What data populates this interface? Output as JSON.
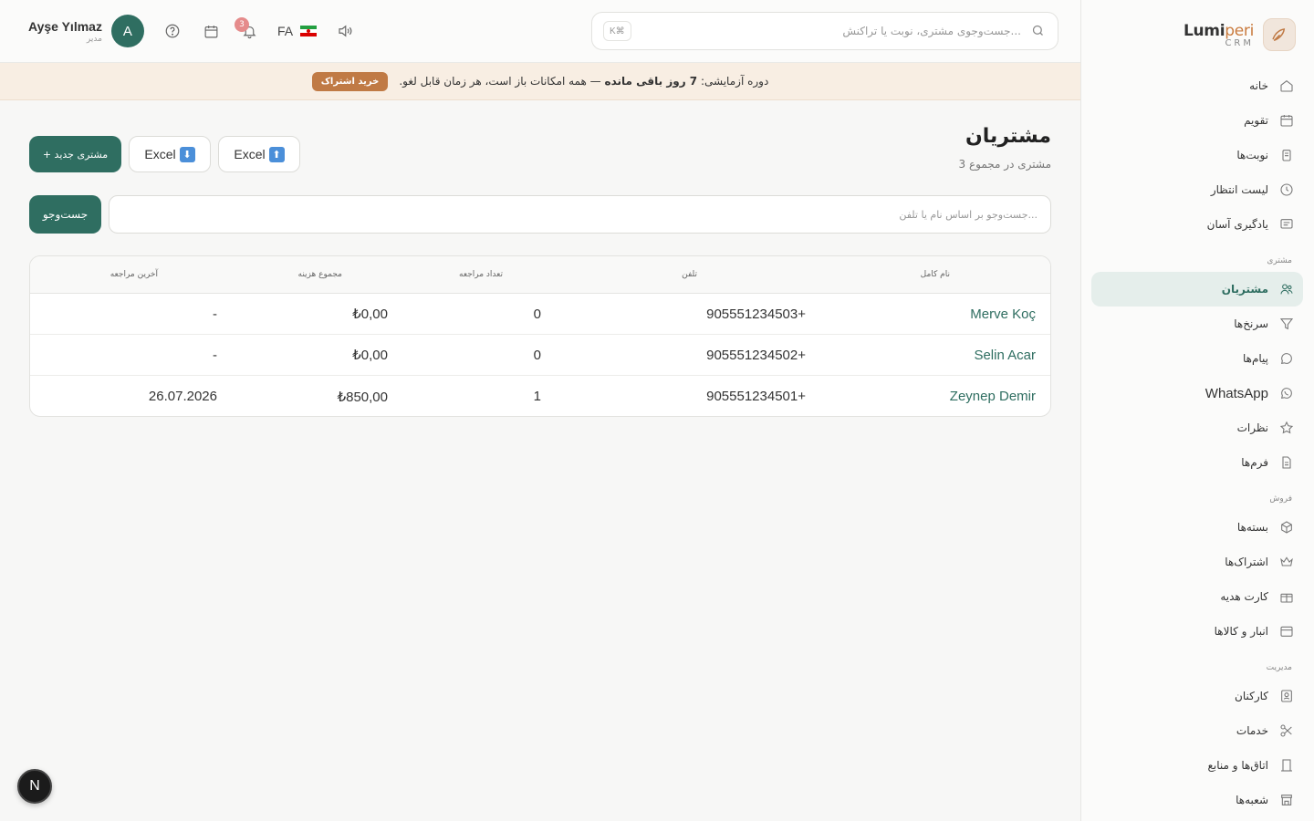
{
  "brand": {
    "name_main": "Lumi",
    "name_accent": "peri",
    "sub": "CRM"
  },
  "topbar": {
    "user_name": "Ayşe Yılmaz",
    "user_role": "مدیر",
    "avatar_initial": "A",
    "notification_count": "3",
    "language": "FA",
    "search_placeholder": "جست‌وجوی مشتری، نوبت یا تراکنش...",
    "search_shortcut": "K⌘"
  },
  "banner": {
    "text_before": "دوره آزمایشی:",
    "text_bold": "7 روز باقی مانده",
    "text_after": "— همه امکانات باز است، هر زمان قابل لغو.",
    "button": "خرید اشتراک"
  },
  "sidebar": {
    "items_top": [
      {
        "label": "خانه",
        "icon": "home-icon"
      },
      {
        "label": "تقویم",
        "icon": "calendar-icon"
      },
      {
        "label": "نوبت‌ها",
        "icon": "clipboard-icon"
      },
      {
        "label": "لیست انتظار",
        "icon": "clock-icon"
      },
      {
        "label": "یادگیری آسان",
        "icon": "message-square-icon"
      }
    ],
    "section_customer": "مشتری",
    "items_customer": [
      {
        "label": "مشتریان",
        "icon": "users-icon",
        "active": true
      },
      {
        "label": "سرنخ‌ها",
        "icon": "funnel-icon"
      },
      {
        "label": "پیام‌ها",
        "icon": "chat-icon"
      },
      {
        "label": "WhatsApp",
        "icon": "whatsapp-icon"
      },
      {
        "label": "نظرات",
        "icon": "star-icon"
      },
      {
        "label": "فرم‌ها",
        "icon": "document-icon"
      }
    ],
    "section_sales": "فروش",
    "items_sales": [
      {
        "label": "بسته‌ها",
        "icon": "box-icon"
      },
      {
        "label": "اشتراک‌ها",
        "icon": "crown-icon"
      },
      {
        "label": "کارت هدیه",
        "icon": "gift-icon"
      },
      {
        "label": "انبار و کالاها",
        "icon": "archive-icon"
      }
    ],
    "section_admin": "مدیریت",
    "items_admin": [
      {
        "label": "کارکنان",
        "icon": "id-badge-icon"
      },
      {
        "label": "خدمات",
        "icon": "scissors-icon"
      },
      {
        "label": "اتاق‌ها و منابع",
        "icon": "door-icon"
      },
      {
        "label": "شعبه‌ها",
        "icon": "store-icon"
      }
    ]
  },
  "page": {
    "title": "مشتریان",
    "subtitle": "3 مشتری در مجموع",
    "new_customer_button": "+ مشتری جدید",
    "export_excel": "Excel",
    "import_excel": "Excel",
    "search_placeholder": "جست‌وجو بر اساس نام یا تلفن...",
    "search_button": "جست‌وجو"
  },
  "table": {
    "headers": {
      "name": "نام کامل",
      "phone": "تلفن",
      "visits": "تعداد مراجعه",
      "spend": "مجموع هزینه",
      "last_visit": "آخرین مراجعه"
    },
    "rows": [
      {
        "name": "Merve Koç",
        "phone": "905551234503+",
        "visits": "0",
        "spend": "₺0,00",
        "last_visit": "-"
      },
      {
        "name": "Selin Acar",
        "phone": "905551234502+",
        "visits": "0",
        "spend": "₺0,00",
        "last_visit": "-"
      },
      {
        "name": "Zeynep Demir",
        "phone": "905551234501+",
        "visits": "1",
        "spend": "₺850,00",
        "last_visit": "26.07.2026"
      }
    ]
  },
  "dev_badge": "N"
}
